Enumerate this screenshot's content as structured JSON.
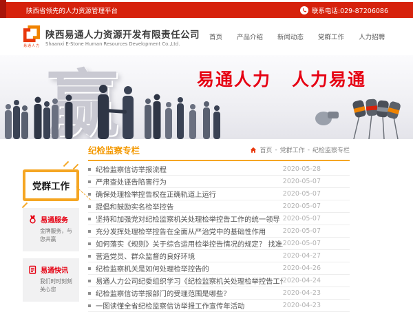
{
  "topbar": {
    "tagline": "陕西省领先的人力资源管理平台",
    "phone_label": "联系电话:029-87206086"
  },
  "header": {
    "company_cn": "陕西易通人力资源开发有限责任公司",
    "company_en": "Shaanxi E-Stone Human Resources Development Co.,Ltd.",
    "logo_subtext": "易通人力",
    "nav": [
      {
        "label": "首页"
      },
      {
        "label": "产品介绍"
      },
      {
        "label": "新闻动态"
      },
      {
        "label": "党群工作"
      },
      {
        "label": "人力招聘"
      }
    ]
  },
  "banner": {
    "win_char": "赢",
    "slogan_left": "易通人力",
    "slogan_right": "人力易通"
  },
  "section": {
    "title": "纪检监察专栏",
    "breadcrumb": {
      "items": [
        "首页",
        "党群工作",
        "纪检监察专栏"
      ],
      "separator": "-"
    }
  },
  "sidebar": {
    "title": "党群工作",
    "cards": [
      {
        "icon": "medal-icon",
        "title": "易通服务",
        "desc": "金牌服务，与您共赢"
      },
      {
        "icon": "news-icon",
        "title": "易通快讯",
        "desc": "我们时时刻刻关心您"
      }
    ]
  },
  "news": {
    "items": [
      {
        "title": "纪检监察信访举报流程",
        "date": "2020-05-28"
      },
      {
        "title": "严肃查处诬告陷害行为",
        "date": "2020-05-07"
      },
      {
        "title": "确保处理检举控告权在正确轨道上运行",
        "date": "2020-05-07"
      },
      {
        "title": "提倡和鼓励实名检举控告",
        "date": "2020-05-07"
      },
      {
        "title": "坚持和加强党对纪检监察机关处理检举控告工作的统一领导",
        "date": "2020-05-07"
      },
      {
        "title": "充分发挥处理检举控告在全面从严治党中的基础性作用",
        "date": "2020-05-07"
      },
      {
        "title": "如何落实《规则》关于综合运用检举控告情况的规定？ 找准工作结合点 推动...",
        "date": "2020-05-07"
      },
      {
        "title": "营造党员、群众监督的良好环境",
        "date": "2020-04-27"
      },
      {
        "title": "纪检监察机关是如何处理检举控告的",
        "date": "2020-04-26"
      },
      {
        "title": "易通人力公司纪委组织学习《纪检监察机关处理检举控告工作规则》",
        "date": "2020-04-24"
      },
      {
        "title": "纪检监察信访举报部门的受理范围是哪些？",
        "date": "2020-04-23"
      },
      {
        "title": "一图读懂全省纪检监察信访举报工作宣传年活动",
        "date": "2020-04-23"
      }
    ]
  },
  "colors": {
    "topbar_red": "#d6220c",
    "topbar_dark_red": "#a8150a",
    "brand_red": "#e60012",
    "logo_orange": "#f08300",
    "accent_orange": "#f5a623",
    "title_orange": "#f39800",
    "text_dark": "#555555",
    "date_gray": "#b3b3b3"
  }
}
